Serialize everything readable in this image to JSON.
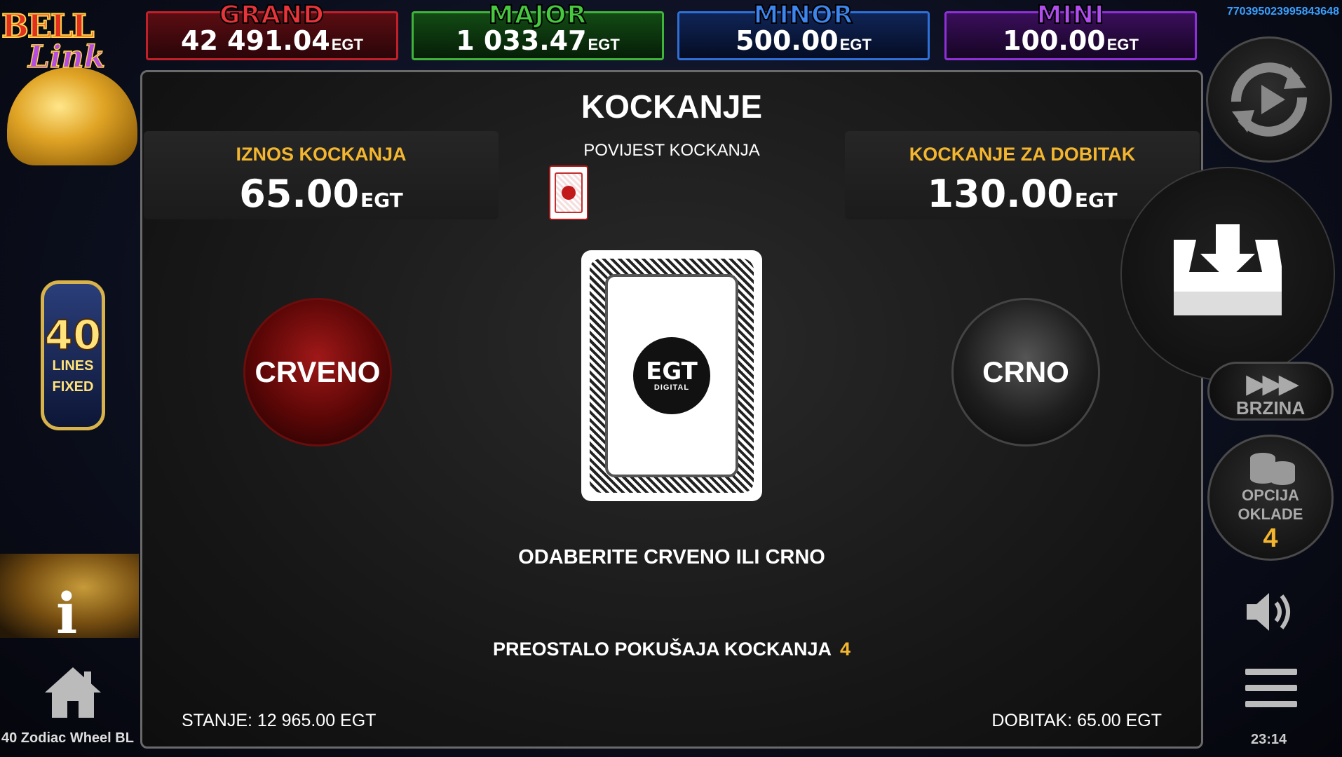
{
  "jackpots": {
    "grand": {
      "title": "GRAND",
      "value": "42 491.04",
      "currency": "EGT"
    },
    "major": {
      "title": "MAJOR",
      "value": "1 033.47",
      "currency": "EGT"
    },
    "minor": {
      "title": "MINOR",
      "value": "500.00",
      "currency": "EGT"
    },
    "mini": {
      "title": "MINI",
      "value": "100.00",
      "currency": "EGT"
    }
  },
  "session_id": "770395023995843648",
  "left_column": {
    "logo_line1": "BELL",
    "logo_line2": "Link",
    "lines_number": "40",
    "lines_label1": "LINES",
    "lines_label2": "FIXED",
    "info_label": "i",
    "game_name": "40 Zodiac Wheel BL"
  },
  "gamble": {
    "title": "KOCKANJE",
    "gamble_amount_label": "IZNOS KOCKANJA",
    "gamble_amount_value": "65.00",
    "gamble_amount_currency": "EGT",
    "history_label": "POVIJEST KOCKANJA",
    "win_to_label": "KOCKANJE ZA DOBITAK",
    "win_to_value": "130.00",
    "win_to_currency": "EGT",
    "red_button": "CRVENO",
    "black_button": "CRNO",
    "card_logo_big": "EGT",
    "card_logo_small": "DIGITAL",
    "prompt": "ODABERITE CRVENO ILI CRNO",
    "attempts_label": "PREOSTALO POKUŠAJA KOCKANJA",
    "attempts_value": "4",
    "balance": "STANJE: 12 965.00 EGT",
    "win": "DOBITAK: 65.00 EGT"
  },
  "right_column": {
    "autoplay_icon": "autoplay-icon",
    "collect_icon": "collect-icon",
    "speed_label": "BRZINA",
    "bet_label_line1": "OPCIJA",
    "bet_label_line2": "OKLADE",
    "bet_value": "4",
    "sound_icon": "speaker-icon",
    "menu_icon": "hamburger-icon",
    "clock": "23:14"
  }
}
